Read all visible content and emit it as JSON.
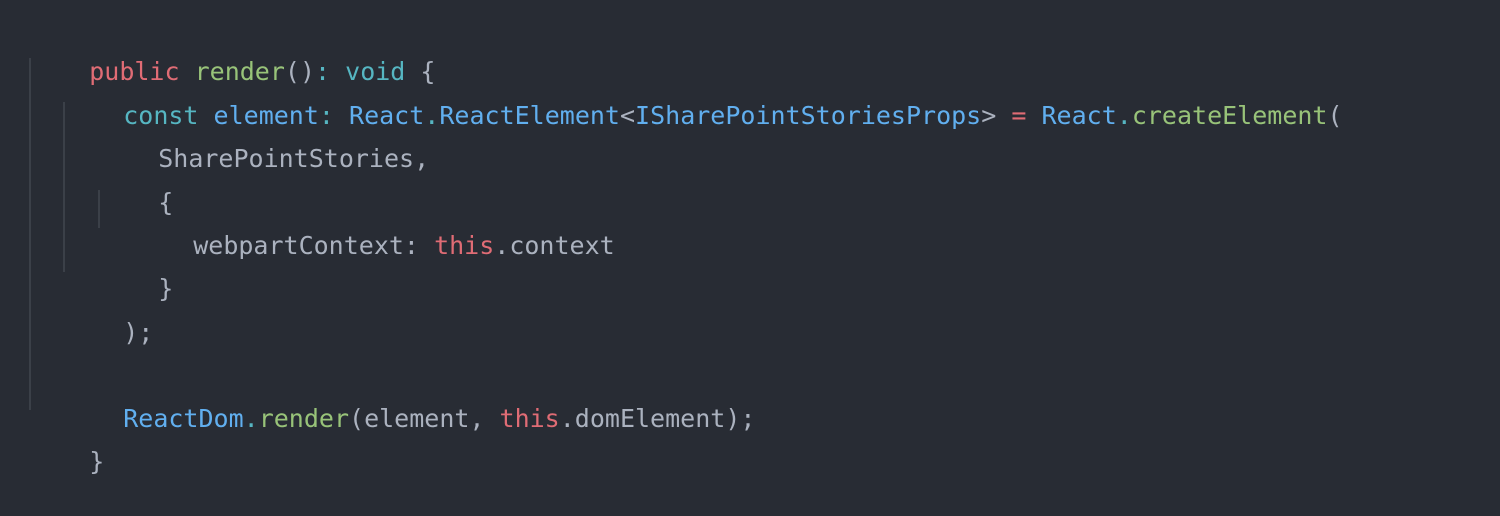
{
  "code": {
    "line1": {
      "public": "public",
      "render": "render",
      "parens": "()",
      "colon": ":",
      "void": "void",
      "brace": "{"
    },
    "line2": {
      "indent": "  ",
      "const": "const",
      "element": "element",
      "colon": ":",
      "react1": "React",
      "dot1": ".",
      "reactElement": "ReactElement",
      "lt": "<",
      "props": "ISharePointStoriesProps",
      "gt": ">",
      "eq": "=",
      "react2": "React",
      "dot2": ".",
      "createElement": "createElement",
      "paren": "("
    },
    "line3": {
      "text": "SharePointStories,"
    },
    "line4": {
      "text": "{"
    },
    "line5": {
      "key": "webpartContext:",
      "this": "this",
      "rest": ".context"
    },
    "line6": {
      "text": "}"
    },
    "line7": {
      "text": ");"
    },
    "line9": {
      "reactDom": "ReactDom",
      "dot": ".",
      "render": "render",
      "args1": "(element, ",
      "this": "this",
      "args2": ".domElement);"
    },
    "line10": {
      "text": "}"
    }
  }
}
